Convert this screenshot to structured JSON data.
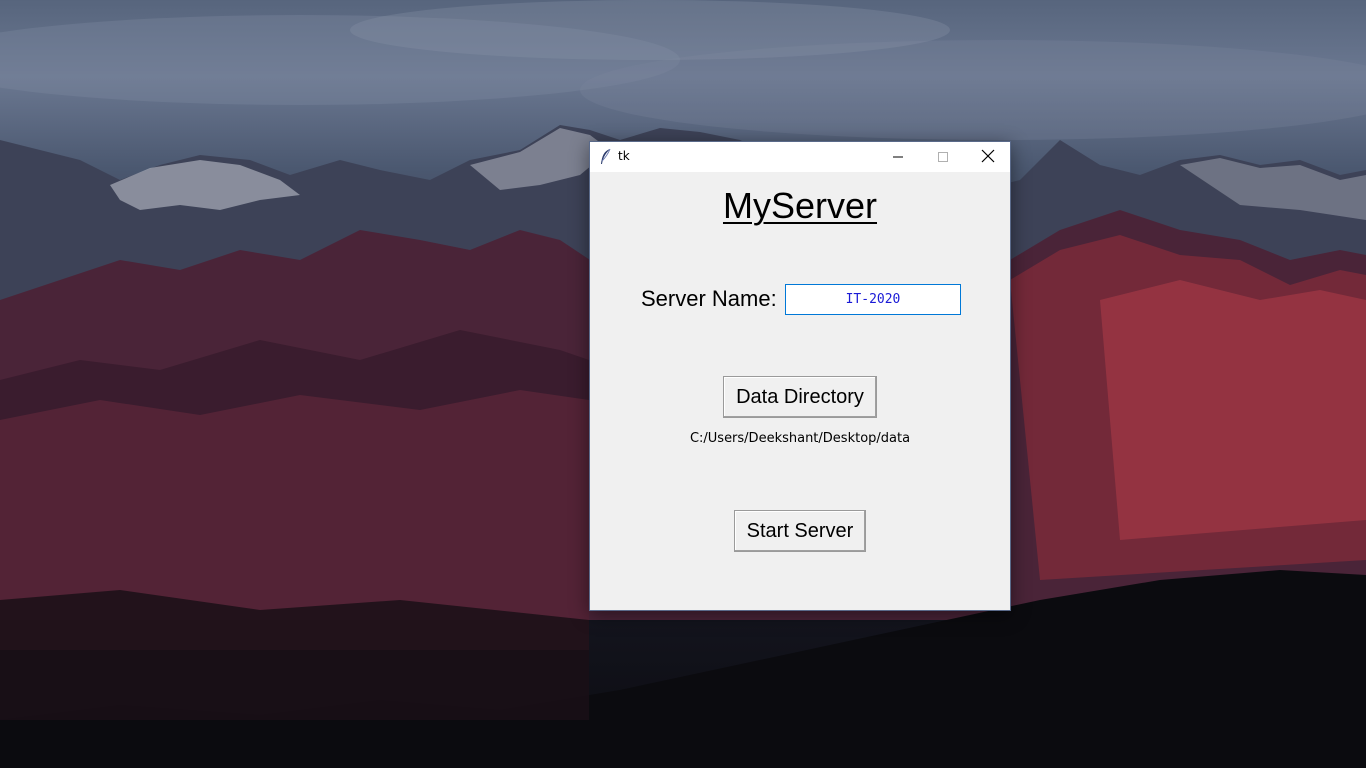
{
  "window": {
    "title": "tk",
    "icon": "feather-icon",
    "controls": {
      "minimize_icon": "minimize-icon",
      "maximize_icon": "maximize-icon",
      "close_icon": "close-icon"
    }
  },
  "app": {
    "title": "MyServer",
    "server_name_label": "Server Name:",
    "server_name_value": "IT-2020",
    "data_directory_button": "Data Directory",
    "data_directory_path": "C:/Users/Deekshant/Desktop/data",
    "start_server_button": "Start Server"
  },
  "colors": {
    "input_border": "#0078d7",
    "input_text": "#1a1ad6",
    "window_bg": "#f0f0f0"
  }
}
